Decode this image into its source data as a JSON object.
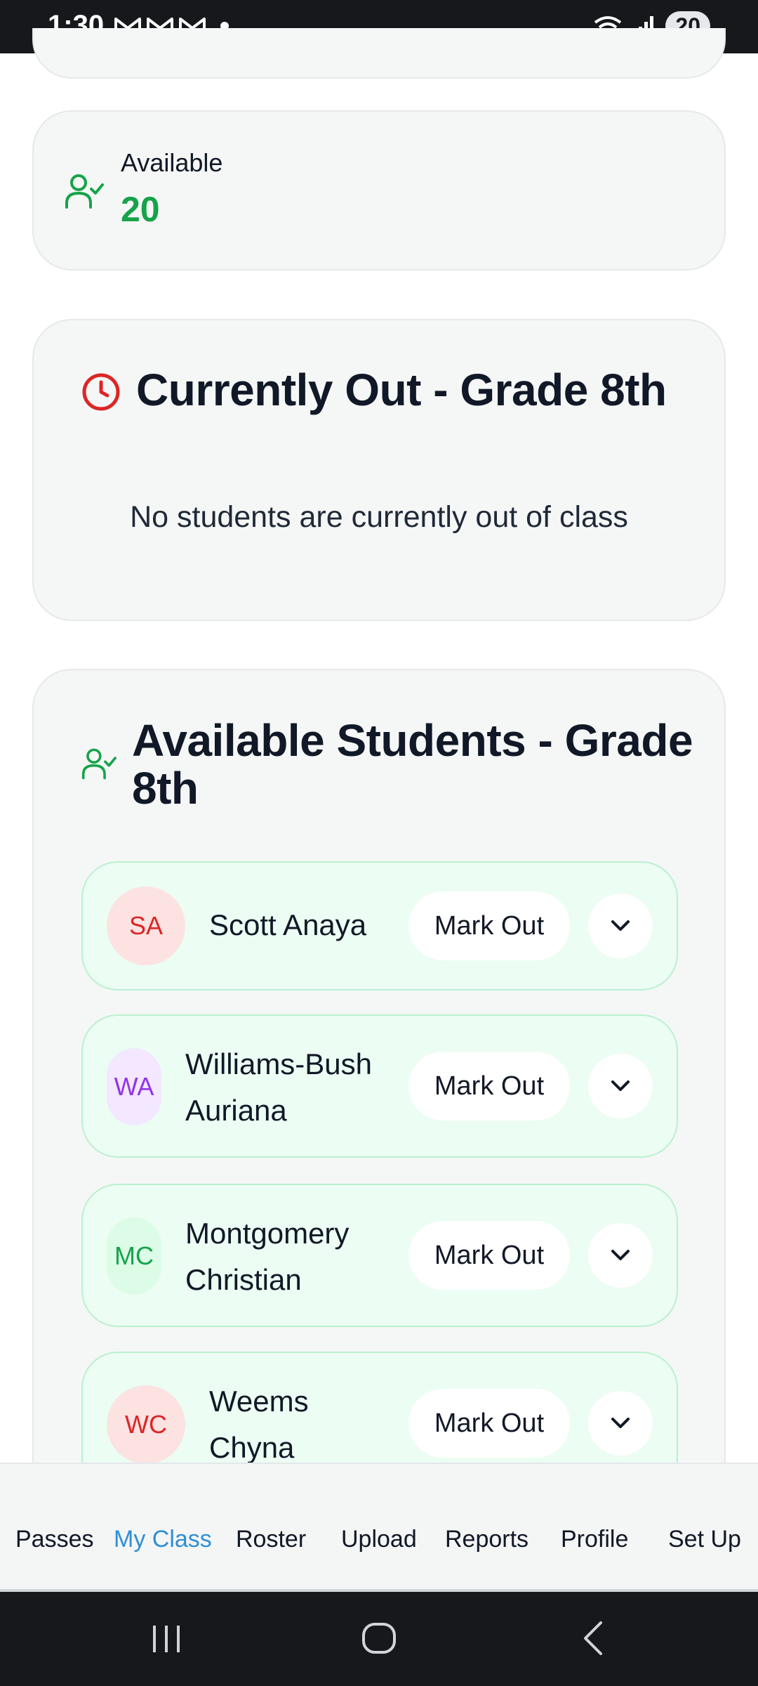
{
  "status_bar": {
    "time": "1:30",
    "notification_icons": [
      "gmail-icon",
      "gmail-icon",
      "gmail-icon"
    ],
    "battery": "20"
  },
  "available_card": {
    "label": "Available",
    "value": "20",
    "accent": "#16a34a"
  },
  "currently_out": {
    "title": "Currently Out - Grade 8th",
    "empty_message": "No students are currently out of class",
    "icon_color": "#dc2626"
  },
  "available_students": {
    "title": "Available Students - Grade 8th",
    "mark_out_label": "Mark Out",
    "students": [
      {
        "initials": "SA",
        "name_line1": "Scott Anaya",
        "name_line2": "",
        "avatar_bg": "#fde2e2",
        "avatar_fg": "#dc2626"
      },
      {
        "initials": "WA",
        "name_line1": "Williams-Bush",
        "name_line2": "Auriana",
        "avatar_bg": "#f3e8ff",
        "avatar_fg": "#9333ea"
      },
      {
        "initials": "MC",
        "name_line1": "Montgomery",
        "name_line2": "Christian",
        "avatar_bg": "#dcfce7",
        "avatar_fg": "#16a34a"
      },
      {
        "initials": "WC",
        "name_line1": "Weems",
        "name_line2": "Chyna",
        "avatar_bg": "#fde2e2",
        "avatar_fg": "#dc2626"
      }
    ]
  },
  "bottom_nav": {
    "active": "My Class",
    "active_color": "#2f8fd6",
    "items": [
      "Passes",
      "My Class",
      "Roster",
      "Upload",
      "Reports",
      "Profile",
      "Set Up"
    ]
  }
}
